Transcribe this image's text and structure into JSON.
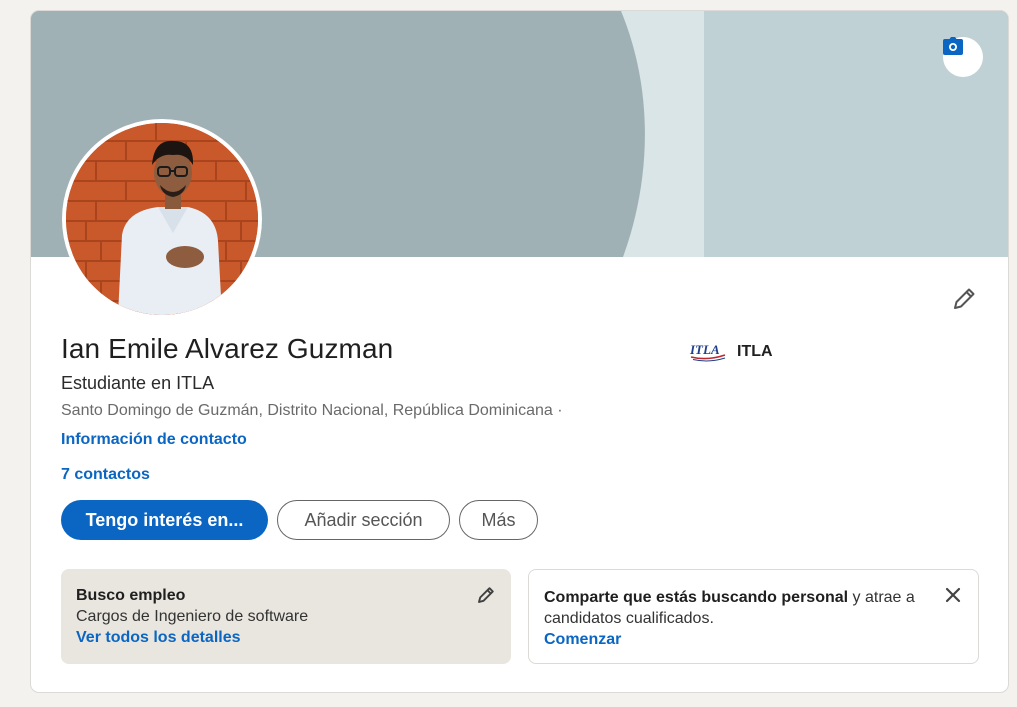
{
  "profile": {
    "name": "Ian Emile Alvarez Guzman",
    "headline": "Estudiante en ITLA",
    "location": "Santo Domingo de Guzmán, Distrito Nacional, República Dominicana ·",
    "contact_info_label": "Información de contacto",
    "connections_label": "7 contactos"
  },
  "education": {
    "logo_text": "ITLA",
    "name": "ITLA"
  },
  "actions": {
    "primary_label": "Tengo interés en...",
    "add_section_label": "Añadir sección",
    "more_label": "Más"
  },
  "open_to_work": {
    "title": "Busco empleo",
    "roles": "Cargos de Ingeniero de software",
    "details_link": "Ver todos los detalles"
  },
  "hiring_prompt": {
    "bold_text": "Comparte que estás buscando personal",
    "rest_text": " y atrae a candidatos cualificados.",
    "cta_link": "Comenzar"
  },
  "colors": {
    "accent": "#0a66c2",
    "banner": "#a0b1b5",
    "open_to_work_bg": "#e9e5df"
  },
  "icons": {
    "camera": "camera-icon",
    "edit": "pencil-icon",
    "close": "close-icon"
  }
}
